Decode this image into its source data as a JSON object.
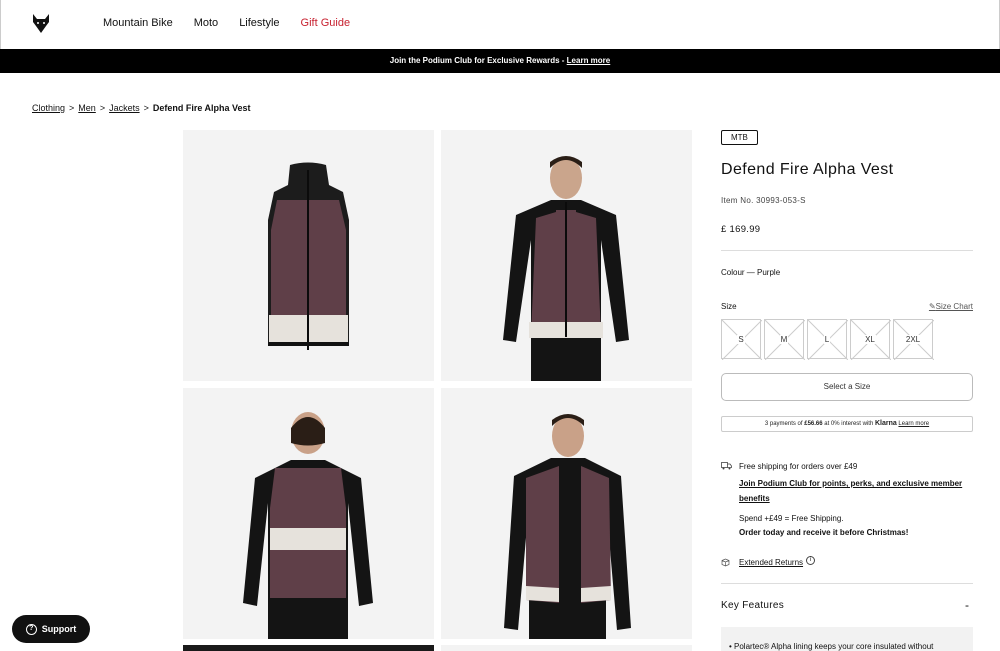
{
  "header": {
    "nav": [
      "Mountain Bike",
      "Moto",
      "Lifestyle",
      "Gift Guide"
    ]
  },
  "promo": {
    "text": "Join the Podium Club for Exclusive Rewards - ",
    "link": "Learn more"
  },
  "breadcrumb": {
    "items": [
      "Clothing",
      "Men",
      "Jackets"
    ],
    "current": "Defend Fire Alpha Vest",
    "sep": ">"
  },
  "product": {
    "badge": "MTB",
    "title": "Defend Fire Alpha Vest",
    "item_no": "Item No. 30993-053-S",
    "price": "£ 169.99",
    "colour": "Colour — Purple",
    "size_label": "Size",
    "size_chart": "Size Chart",
    "sizes": [
      "S",
      "M",
      "L",
      "XL",
      "2XL"
    ],
    "select_button": "Select a Size",
    "klarna": {
      "pre": "3 payments of ",
      "amount": "£56.66",
      "mid": " at 0% interest with ",
      "brand": "Klarna",
      "link": "Learn more"
    }
  },
  "shipping": {
    "free": "Free shipping for orders over £49",
    "podium": "Join Podium Club for points, perks, and exclusive member benefits",
    "spend": "Spend +£49 = Free Shipping.",
    "order": "Order today and receive it before Christmas!"
  },
  "returns": {
    "label": "Extended Returns",
    "info": "i"
  },
  "key_features": {
    "title": "Key Features",
    "toggle": "-",
    "first_item": "• Polartec® Alpha lining keeps your core insulated without"
  },
  "support": {
    "label": "Support",
    "icon": "?"
  },
  "colors": {
    "vest": "#5f3f48",
    "accent": "#c7202f",
    "tile_bg": "#f3f3f3"
  }
}
